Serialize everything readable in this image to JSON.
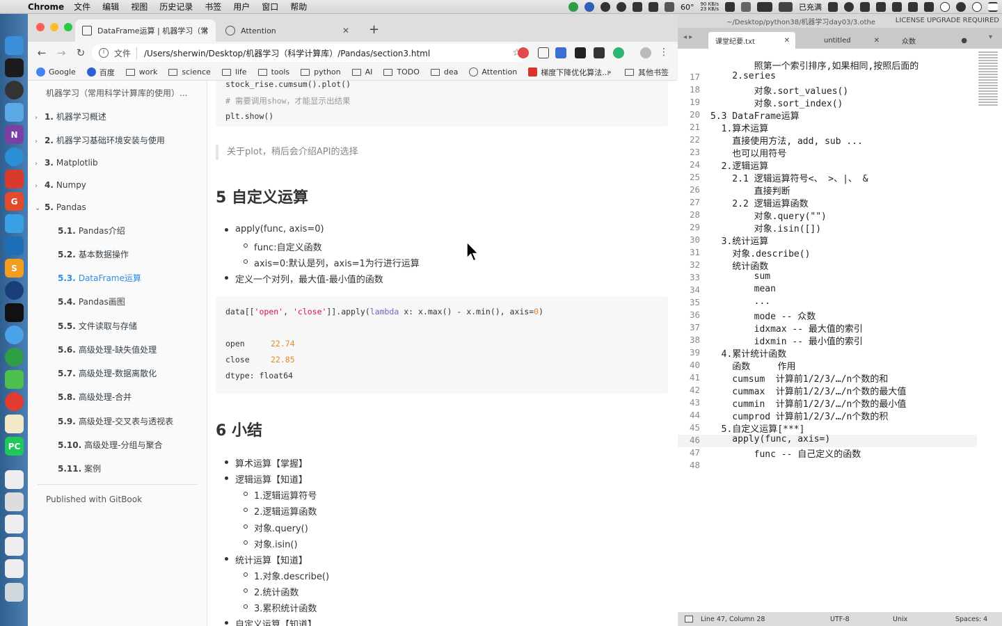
{
  "menubar": {
    "app": "Chrome",
    "items": [
      "文件",
      "编辑",
      "视图",
      "历史记录",
      "书签",
      "用户",
      "窗口",
      "帮助"
    ],
    "temp": "60°",
    "net_up": "90 KB/s",
    "net_down": "23 KB/s",
    "battery": "已充满"
  },
  "browser": {
    "tabs": [
      {
        "title": "DataFrame运算 | 机器学习（常",
        "active": true
      },
      {
        "title": "Attention",
        "active": false
      }
    ],
    "address": {
      "scheme": "文件",
      "url": "/Users/sherwin/Desktop/机器学习（科学计算库）/Pandas/section3.html"
    },
    "bookmarks": [
      "Google",
      "百度",
      "work",
      "science",
      "life",
      "tools",
      "python",
      "AI",
      "TODO",
      "dea",
      "Attention",
      "梯度下降优化算法...",
      "»",
      "其他书签"
    ]
  },
  "sidebar": {
    "book_title": "机器学习（常用科学计算库的使用）...",
    "items": [
      {
        "num": "1.",
        "label": "机器学习概述"
      },
      {
        "num": "2.",
        "label": "机器学习基础环境安装与使用"
      },
      {
        "num": "3.",
        "label": "Matplotlib"
      },
      {
        "num": "4.",
        "label": "Numpy"
      },
      {
        "num": "5.",
        "label": "Pandas"
      },
      {
        "num": "5.1.",
        "label": "Pandas介绍"
      },
      {
        "num": "5.2.",
        "label": "基本数据操作"
      },
      {
        "num": "5.3.",
        "label": "DataFrame运算"
      },
      {
        "num": "5.4.",
        "label": "Pandas画图"
      },
      {
        "num": "5.5.",
        "label": "文件读取与存储"
      },
      {
        "num": "5.6.",
        "label": "高级处理-缺失值处理"
      },
      {
        "num": "5.7.",
        "label": "高级处理-数据离散化"
      },
      {
        "num": "5.8.",
        "label": "高级处理-合并"
      },
      {
        "num": "5.9.",
        "label": "高级处理-交叉表与透视表"
      },
      {
        "num": "5.10.",
        "label": "高级处理-分组与聚合"
      },
      {
        "num": "5.11.",
        "label": "案例"
      }
    ],
    "footer": "Published with GitBook"
  },
  "content": {
    "code1": [
      "stock_rise.cumsum().plot()",
      "# 需要调用show，才能显示出结果",
      "plt.show()"
    ],
    "quote": "关于plot，稍后会介绍API的选择",
    "h_custom": "5 自定义运算",
    "custom_list": [
      "apply(func, axis=0)",
      "func:自定义函数",
      "axis=0:默认是列，axis=1为行进行运算",
      "定义一个对列，最大值-最小值的函数"
    ],
    "code2": {
      "p1": "data[[",
      "s1": "'open'",
      "p2": ", ",
      "s2": "'close'",
      "p3": "]].apply(",
      "kw": "lambda",
      "p4": " x: x.max() - x.min(), axis=",
      "n": "0",
      "p5": ")",
      "out": [
        {
          "k": "open",
          "v": "22.74"
        },
        {
          "k": "close",
          "v": "22.85"
        }
      ],
      "dtype": "dtype: float64"
    },
    "h_summary": "6 小结",
    "summary_list": [
      "算术运算【掌握】",
      "逻辑运算【知道】",
      "1.逻辑运算符号",
      "2.逻辑运算函数",
      "对象.query()",
      "对象.isin()",
      "统计运算【知道】",
      "1.对象.describe()",
      "2.统计函数",
      "3.累积统计函数",
      "自定义运算【知道】"
    ]
  },
  "editor": {
    "path": "~/Desktop/python38/机器学习day03/3.othe",
    "license": "LICENSE UPGRADE REQUIRED",
    "tabs": [
      "课堂纪要.txt",
      "untitled",
      "众数"
    ],
    "lines": [
      {
        "n": "",
        "t": "        照第一个索引排序,如果相同,按照后面的"
      },
      {
        "n": "17",
        "t": "    2.series"
      },
      {
        "n": "18",
        "t": "        对象.sort_values()"
      },
      {
        "n": "19",
        "t": "        对象.sort_index()"
      },
      {
        "n": "20",
        "t": "5.3 DataFrame运算"
      },
      {
        "n": "21",
        "t": "  1.算术运算"
      },
      {
        "n": "22",
        "t": "    直接使用方法, add, sub ..."
      },
      {
        "n": "23",
        "t": "    也可以用符号"
      },
      {
        "n": "24",
        "t": "  2.逻辑运算"
      },
      {
        "n": "25",
        "t": "    2.1 逻辑运算符号<、 >、|、 &"
      },
      {
        "n": "26",
        "t": "        直接判断"
      },
      {
        "n": "27",
        "t": "    2.2 逻辑运算函数"
      },
      {
        "n": "28",
        "t": "        对象.query(\"\")"
      },
      {
        "n": "29",
        "t": "        对象.isin([])"
      },
      {
        "n": "30",
        "t": "  3.统计运算"
      },
      {
        "n": "31",
        "t": "    对象.describe()"
      },
      {
        "n": "32",
        "t": "    统计函数"
      },
      {
        "n": "33",
        "t": "        sum"
      },
      {
        "n": "34",
        "t": "        mean"
      },
      {
        "n": "35",
        "t": "        ..."
      },
      {
        "n": "36",
        "t": "        mode -- 众数"
      },
      {
        "n": "37",
        "t": "        idxmax -- 最大值的索引"
      },
      {
        "n": "38",
        "t": "        idxmin -- 最小值的索引"
      },
      {
        "n": "39",
        "t": "  4.累计统计函数"
      },
      {
        "n": "40",
        "t": "    函数     作用"
      },
      {
        "n": "41",
        "t": "    cumsum  计算前1/2/3/…/n个数的和"
      },
      {
        "n": "42",
        "t": "    cummax  计算前1/2/3/…/n个数的最大值"
      },
      {
        "n": "43",
        "t": "    cummin  计算前1/2/3/…/n个数的最小值"
      },
      {
        "n": "44",
        "t": "    cumprod 计算前1/2/3/…/n个数的积"
      },
      {
        "n": "45",
        "t": "  5.自定义运算[***]"
      },
      {
        "n": "46",
        "t": "    apply(func, axis=)"
      },
      {
        "n": "47",
        "t": "        func -- 自己定义的函数"
      },
      {
        "n": "48",
        "t": ""
      }
    ],
    "status": {
      "pos": "Line 47, Column 28",
      "enc": "UTF-8",
      "le": "Unix",
      "indent": "Spaces: 4"
    }
  }
}
